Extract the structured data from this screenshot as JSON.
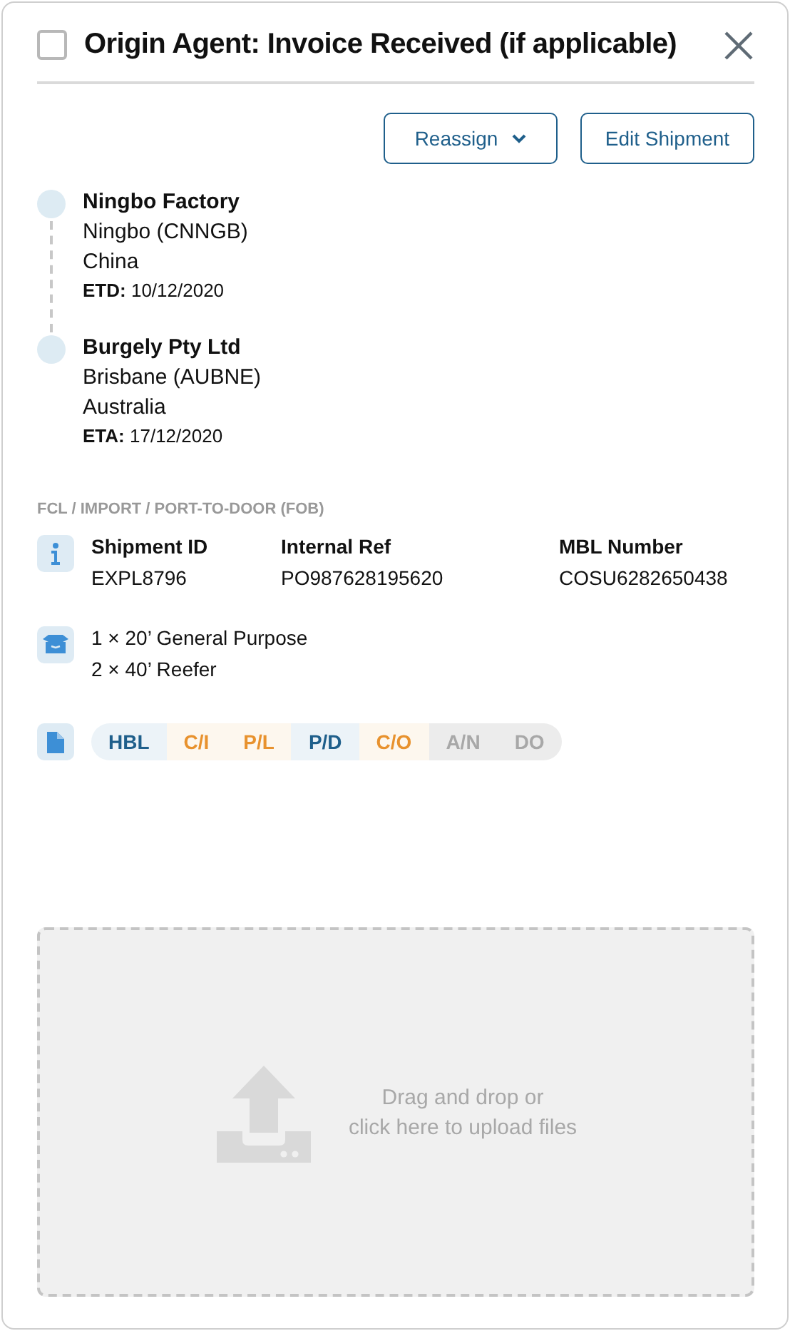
{
  "header": {
    "checked": false,
    "title": "Origin Agent: Invoice Received (if applicable)"
  },
  "actions": [
    {
      "label": "Reassign",
      "dropdown": true
    },
    {
      "label": "Edit Shipment",
      "dropdown": false
    }
  ],
  "route": [
    {
      "name": "Ningbo Factory",
      "city": "Ningbo (CNNGB)",
      "country": "China",
      "date_label": "ETD:",
      "date": "10/12/2020"
    },
    {
      "name": "Burgely Pty Ltd",
      "city": "Brisbane (AUBNE)",
      "country": "Australia",
      "date_label": "ETA:",
      "date": "17/12/2020"
    }
  ],
  "mode": "FCL / IMPORT / PORT-TO-DOOR (FOB)",
  "details": [
    {
      "label": "Shipment ID",
      "value": "EXPL8796"
    },
    {
      "label": "Internal Ref",
      "value": "PO987628195620"
    },
    {
      "label": "MBL Number",
      "value": "COSU6282650438"
    }
  ],
  "containers": [
    "1 × 20’ General Purpose",
    "2 × 40’ Reefer"
  ],
  "documents": [
    {
      "label": "HBL",
      "kind": "received"
    },
    {
      "label": "C/I",
      "kind": "pending"
    },
    {
      "label": "P/L",
      "kind": "pending"
    },
    {
      "label": "P/D",
      "kind": "received"
    },
    {
      "label": "C/O",
      "kind": "pending"
    },
    {
      "label": "A/N",
      "kind": "missing"
    },
    {
      "label": "DO",
      "kind": "missing"
    }
  ],
  "upload": {
    "lines": [
      "Drag and drop or",
      "click here to upload files"
    ]
  }
}
